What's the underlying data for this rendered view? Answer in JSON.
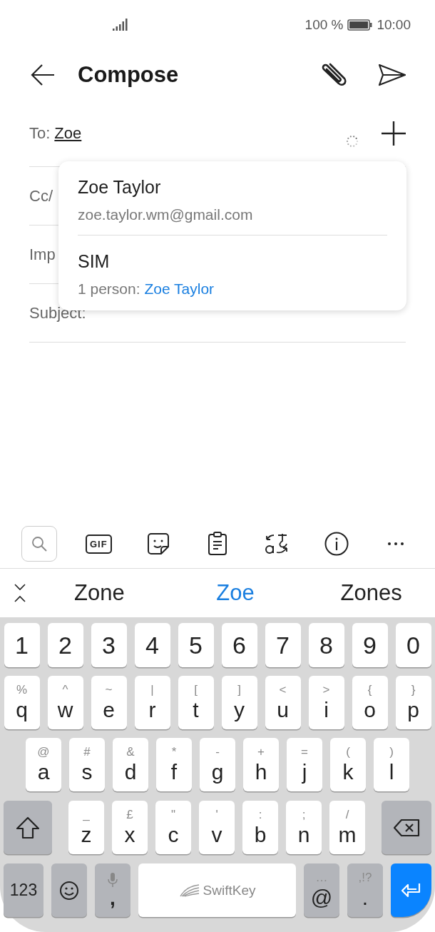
{
  "status_bar": {
    "battery_text": "100 %",
    "time": "10:00"
  },
  "header": {
    "title": "Compose"
  },
  "fields": [
    {
      "label": "To:",
      "value": "Zoe"
    },
    {
      "label": "Cc/"
    },
    {
      "label": "Imp"
    },
    {
      "label": "Subject:"
    }
  ],
  "contact_suggestions": [
    {
      "name": "Zoe Taylor",
      "detail": "zoe.taylor.wm@gmail.com"
    },
    {
      "name": "SIM",
      "detail": "1 person: ",
      "link": "Zoe Taylor"
    }
  ],
  "keyboard_toolbar": [
    {
      "kind": "search",
      "selected": true
    },
    {
      "kind": "gif",
      "label": "GIF",
      "selected": false
    },
    {
      "kind": "sticker",
      "selected": false
    },
    {
      "kind": "clipboard",
      "selected": false
    },
    {
      "kind": "translate",
      "selected": false
    },
    {
      "kind": "info",
      "selected": false
    },
    {
      "kind": "more",
      "selected": false
    }
  ],
  "predictions": [
    {
      "text": "Zone",
      "selected": false
    },
    {
      "text": "Zoe",
      "selected": true
    },
    {
      "text": "Zones",
      "selected": false
    }
  ],
  "keyboard_rows": [
    [
      {
        "kind": "char",
        "main": "1"
      },
      {
        "kind": "char",
        "main": "2"
      },
      {
        "kind": "char",
        "main": "3"
      },
      {
        "kind": "char",
        "main": "4"
      },
      {
        "kind": "char",
        "main": "5"
      },
      {
        "kind": "char",
        "main": "6"
      },
      {
        "kind": "char",
        "main": "7"
      },
      {
        "kind": "char",
        "main": "8"
      },
      {
        "kind": "char",
        "main": "9"
      },
      {
        "kind": "char",
        "main": "0"
      }
    ],
    [
      {
        "kind": "char",
        "main": "q",
        "hint": "%"
      },
      {
        "kind": "char",
        "main": "w",
        "hint": "^"
      },
      {
        "kind": "char",
        "main": "e",
        "hint": "~"
      },
      {
        "kind": "char",
        "main": "r",
        "hint": "|"
      },
      {
        "kind": "char",
        "main": "t",
        "hint": "["
      },
      {
        "kind": "char",
        "main": "y",
        "hint": "]"
      },
      {
        "kind": "char",
        "main": "u",
        "hint": "<"
      },
      {
        "kind": "char",
        "main": "i",
        "hint": ">"
      },
      {
        "kind": "char",
        "main": "o",
        "hint": "{"
      },
      {
        "kind": "char",
        "main": "p",
        "hint": "}"
      }
    ],
    [
      {
        "kind": "char",
        "main": "a",
        "hint": "@"
      },
      {
        "kind": "char",
        "main": "s",
        "hint": "#"
      },
      {
        "kind": "char",
        "main": "d",
        "hint": "&"
      },
      {
        "kind": "char",
        "main": "f",
        "hint": "*"
      },
      {
        "kind": "char",
        "main": "g",
        "hint": "-"
      },
      {
        "kind": "char",
        "main": "h",
        "hint": "+"
      },
      {
        "kind": "char",
        "main": "j",
        "hint": "="
      },
      {
        "kind": "char",
        "main": "k",
        "hint": "("
      },
      {
        "kind": "char",
        "main": "l",
        "hint": ")"
      }
    ],
    [
      {
        "kind": "shift"
      },
      {
        "kind": "char",
        "main": "z",
        "hint": "_"
      },
      {
        "kind": "char",
        "main": "x",
        "hint": "£"
      },
      {
        "kind": "char",
        "main": "c",
        "hint": "\""
      },
      {
        "kind": "char",
        "main": "v",
        "hint": "'"
      },
      {
        "kind": "char",
        "main": "b",
        "hint": ":"
      },
      {
        "kind": "char",
        "main": "n",
        "hint": ";"
      },
      {
        "kind": "char",
        "main": "m",
        "hint": "/"
      },
      {
        "kind": "backspace"
      }
    ],
    [
      {
        "kind": "mode",
        "main": "123"
      },
      {
        "kind": "emoji"
      },
      {
        "kind": "mic",
        "main": ","
      },
      {
        "kind": "space",
        "main": "SwiftKey"
      },
      {
        "kind": "func",
        "main": "@",
        "hint": "…"
      },
      {
        "kind": "func",
        "main": ".",
        "hint": ",!?"
      },
      {
        "kind": "enter"
      }
    ]
  ]
}
